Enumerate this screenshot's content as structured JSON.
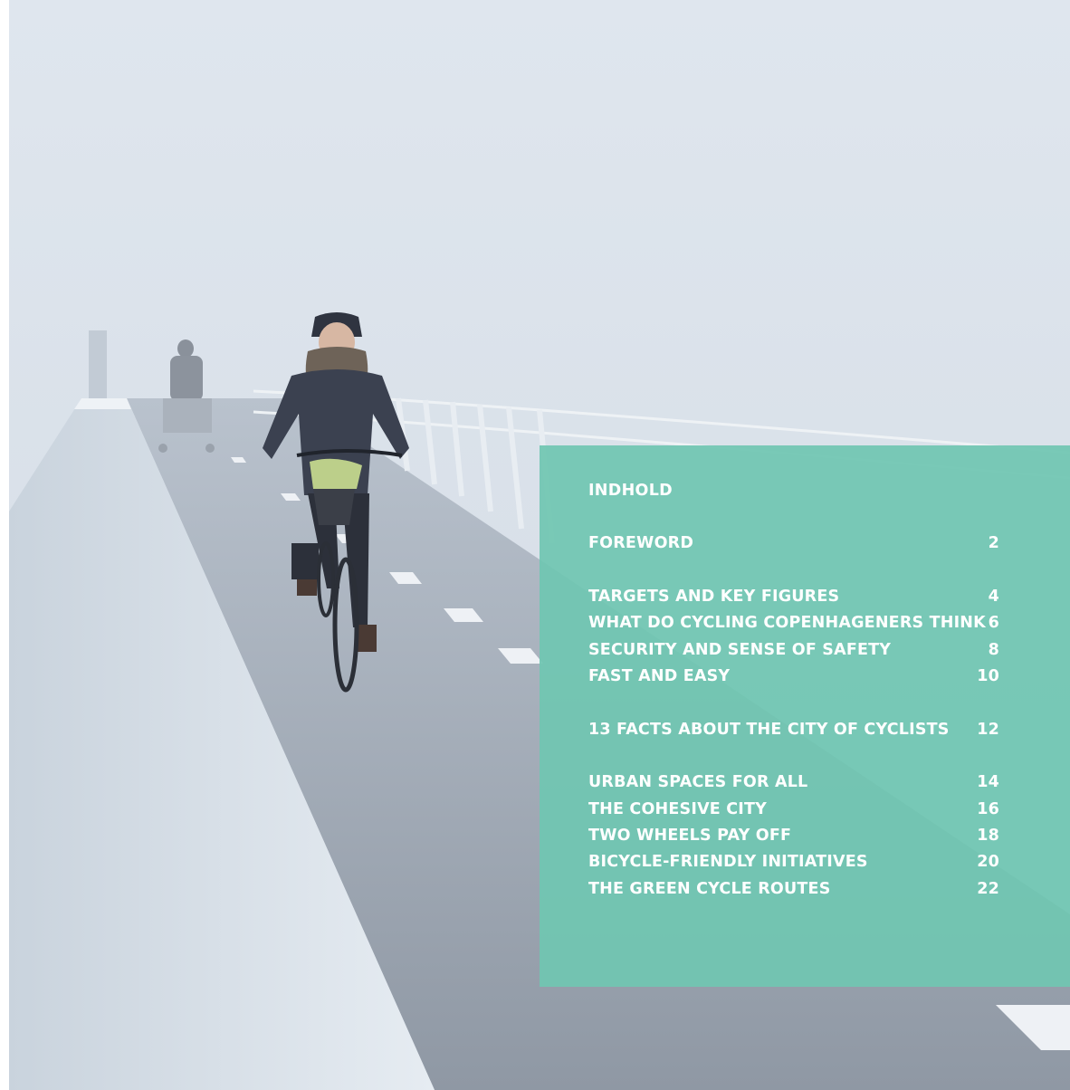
{
  "photo": {
    "subject": "cyclist-on-foggy-bridge-photo"
  },
  "toc": {
    "title": "INDHOLD",
    "entries": [
      {
        "title": "FOREWORD",
        "page": "2"
      },
      {
        "title": "TARGETS AND KEY FIGURES",
        "page": "4"
      },
      {
        "title": "WHAT DO CYCLING COPENHAGENERS THINK",
        "page": "6"
      },
      {
        "title": "SECURITY AND SENSE OF SAFETY",
        "page": "8"
      },
      {
        "title": "FAST AND EASY",
        "page": "10"
      },
      {
        "title": "13 FACTS ABOUT THE CITY OF CYCLISTS",
        "page": "12"
      },
      {
        "title": "URBAN SPACES FOR ALL",
        "page": "14"
      },
      {
        "title": "THE COHESIVE CITY",
        "page": "16"
      },
      {
        "title": "TWO WHEELS PAY OFF",
        "page": "18"
      },
      {
        "title": "BICYCLE-FRIENDLY INITIATIVES",
        "page": "20"
      },
      {
        "title": "THE GREEN CYCLE ROUTES",
        "page": "22"
      }
    ],
    "color": "#70c6b2"
  }
}
